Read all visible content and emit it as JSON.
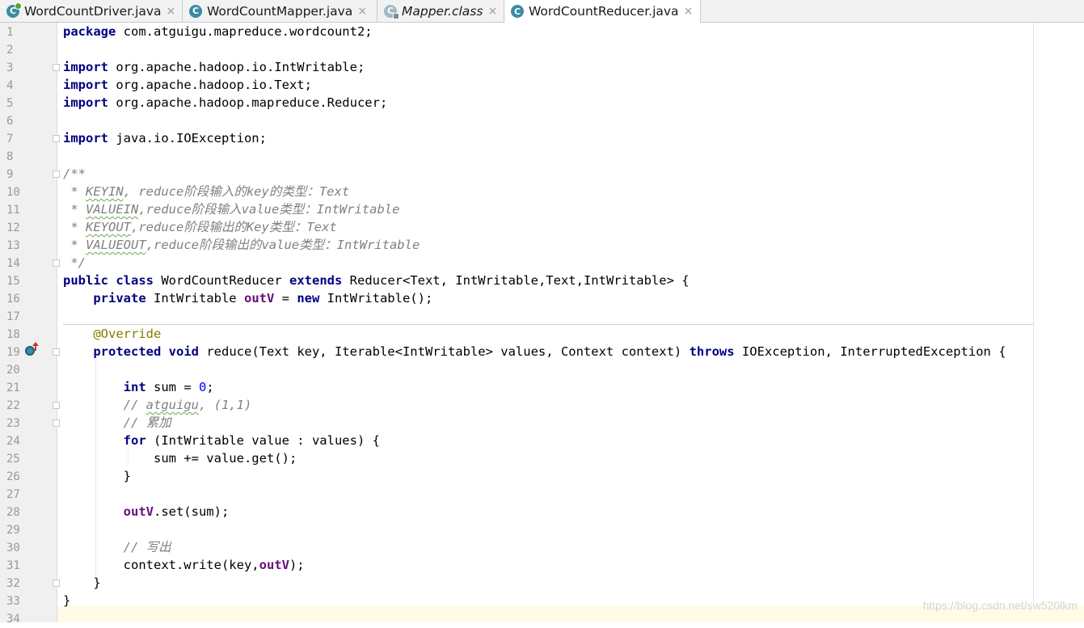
{
  "tabs": [
    {
      "label": "WordCountDriver.java",
      "close": "×",
      "icon": "class-run-icon"
    },
    {
      "label": "WordCountMapper.java",
      "close": "×",
      "icon": "class-icon"
    },
    {
      "label": "Mapper.class",
      "close": "×",
      "icon": "compiled-class-icon"
    },
    {
      "label": "WordCountReducer.java",
      "close": "×",
      "icon": "class-icon"
    }
  ],
  "active_tab": "WordCountReducer.java",
  "line_numbers": [
    "1",
    "2",
    "3",
    "4",
    "5",
    "6",
    "7",
    "8",
    "9",
    "10",
    "11",
    "12",
    "13",
    "14",
    "15",
    "16",
    "17",
    "18",
    "19",
    "20",
    "21",
    "22",
    "23",
    "24",
    "25",
    "26",
    "27",
    "28",
    "29",
    "30",
    "31",
    "32",
    "33",
    "34"
  ],
  "code": {
    "l1_kw": "package",
    "l1_rest": " com.atguigu.mapreduce.wordcount2;",
    "l3_kw": "import",
    "l3_rest": " org.apache.hadoop.io.IntWritable;",
    "l4_kw": "import",
    "l4_rest": " org.apache.hadoop.io.Text;",
    "l5_kw": "import",
    "l5_rest": " org.apache.hadoop.mapreduce.Reducer;",
    "l7_kw": "import",
    "l7_rest": " java.io.IOException;",
    "l9": "/**",
    "l10_a": " * ",
    "l10_w": "KEYIN",
    "l10_b": ", reduce阶段输入的key的类型：Text",
    "l11_a": " * ",
    "l11_w": "VALUEIN",
    "l11_b": ",reduce阶段输入value类型：IntWritable",
    "l12_a": " * ",
    "l12_w": "KEYOUT",
    "l12_b": ",reduce阶段输出的Key类型：Text",
    "l13_a": " * ",
    "l13_w": "VALUEOUT",
    "l13_b": ",reduce阶段输出的value类型：IntWritable",
    "l14": " */",
    "l15_kw1": "public",
    "l15_kw2": "class",
    "l15_name": " WordCountReducer ",
    "l15_kw3": "extends",
    "l15_rest": " Reducer<Text, IntWritable,Text,IntWritable> {",
    "l16_kw": "    private",
    "l16_type": " IntWritable ",
    "l16_fld": "outV",
    "l16_eq": " = ",
    "l16_new": "new",
    "l16_rest": " IntWritable();",
    "l18": "    @Override",
    "l19_kw1": "    protected",
    "l19_kw2": "void",
    "l19_mid": " reduce(Text key, Iterable<IntWritable> values, Context context) ",
    "l19_kw3": "throws",
    "l19_rest": " IOException, InterruptedException {",
    "l21_kw": "        int",
    "l21_mid": " sum = ",
    "l21_num": "0",
    "l21_end": ";",
    "l22_a": "        // ",
    "l22_w": "atguigu",
    "l22_b": ", (1,1)",
    "l23": "        // 累加",
    "l24_kw": "        for",
    "l24_rest": " (IntWritable value : values) {",
    "l25": "            sum += value.get();",
    "l26": "        }",
    "l28_fld": "outV",
    "l28_rest": ".set(sum);",
    "l30": "        // 写出",
    "l31_a": "        context.write(key,",
    "l31_fld": "outV",
    "l31_b": ");",
    "l32": "    }",
    "l33": "}"
  },
  "watermark": "https://blog.csdn.net/sw520lkm",
  "colors": {
    "keyword": "#000080",
    "field": "#660e7a",
    "number": "#0000ff",
    "annotation": "#808000",
    "comment": "#808080"
  }
}
